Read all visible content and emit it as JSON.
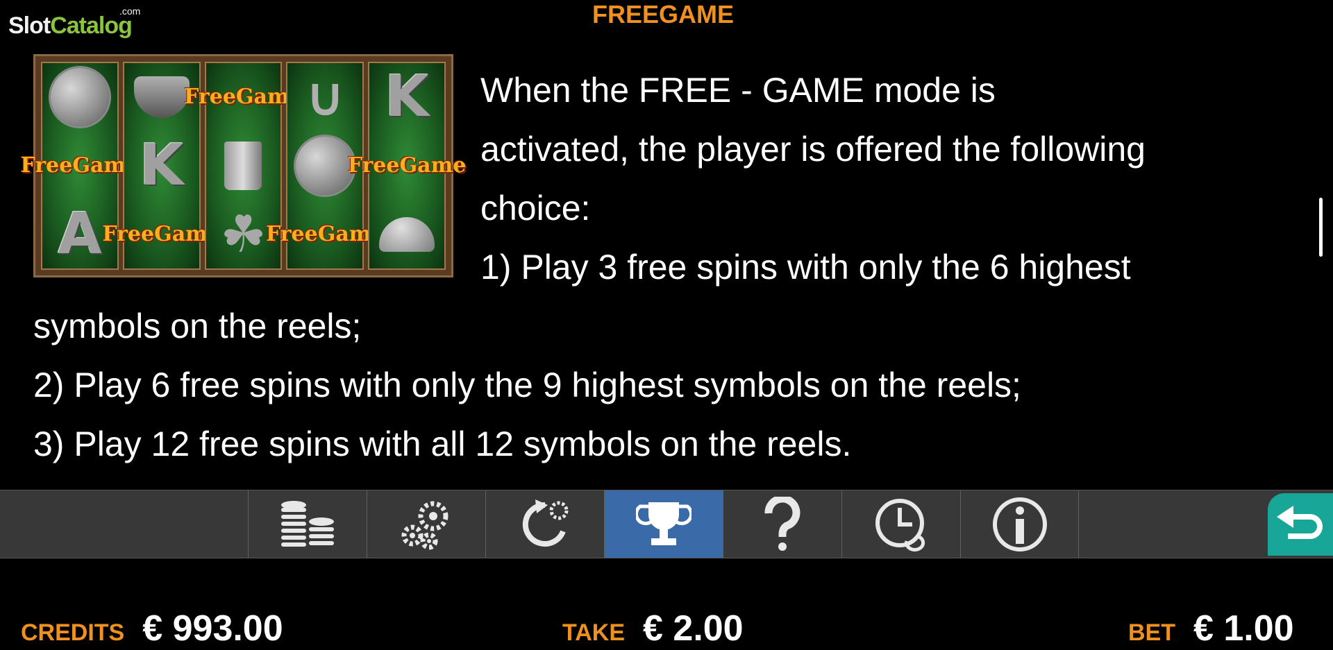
{
  "logo": {
    "slot": "Slot",
    "catalog": "Catalog",
    "com": ".com"
  },
  "page_title": "FREEGAME",
  "reel_image": {
    "reels": [
      [
        "woman-portrait",
        "free-game",
        "A"
      ],
      [
        "top-hat",
        "K",
        "free-game"
      ],
      [
        "free-game",
        "beer-mug",
        "clover"
      ],
      [
        "horseshoes",
        "woman-portrait",
        "free-game"
      ],
      [
        "K",
        "free-game",
        "mushrooms"
      ]
    ],
    "free_game_text": [
      "Free",
      "Game"
    ]
  },
  "paragraph": {
    "lines": [
      "When the FREE - GAME mode is",
      "activated, the player is offered the following",
      "choice:",
      "1) Play 3 free spins with only the 6 highest",
      "symbols on the reels;",
      "2) Play 6 free spins with only the 9 highest symbols on the reels;",
      "3) Play 12 free spins with all 12 symbols on the reels."
    ]
  },
  "toolbar": {
    "buttons": [
      {
        "icon": "coins-icon",
        "active": false
      },
      {
        "icon": "gears-icon",
        "active": false
      },
      {
        "icon": "autoplay-icon",
        "active": false
      },
      {
        "icon": "trophy-icon",
        "active": true
      },
      {
        "icon": "help-icon",
        "active": false
      },
      {
        "icon": "history-icon",
        "active": false
      },
      {
        "icon": "info-icon",
        "active": false
      }
    ],
    "back_icon": "back-arrow-icon",
    "active_color": "#3a6aa8",
    "back_color": "#17a697"
  },
  "status": {
    "credits_label": "CREDITS",
    "credits_value": "€ 993.00",
    "take_label": "TAKE",
    "take_value": "€ 2.00",
    "bet_label": "BET",
    "bet_value": "€ 1.00"
  },
  "colors": {
    "accent": "#f0901e",
    "background": "#000000",
    "toolbar": "#383838"
  }
}
